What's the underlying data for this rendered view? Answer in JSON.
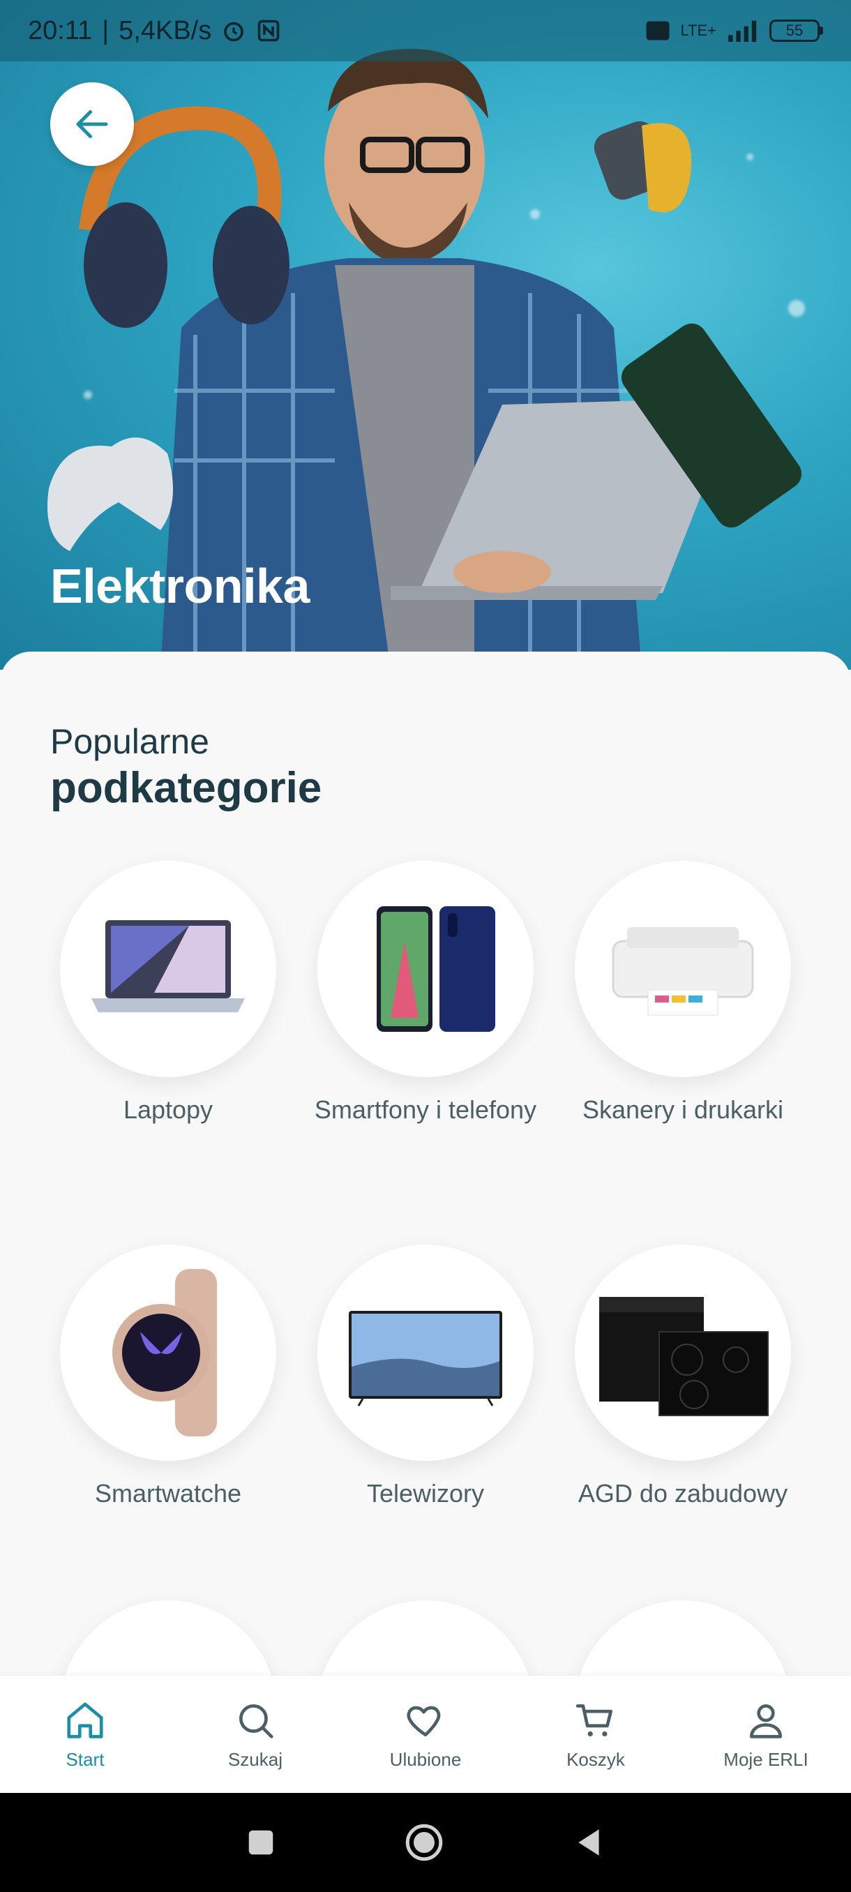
{
  "status_bar": {
    "time": "20:11",
    "speed": "5,4KB/s",
    "network": "LTE+",
    "battery": "55"
  },
  "hero": {
    "title": "Elektronika"
  },
  "section": {
    "subtitle": "Popularne",
    "title": "podkategorie"
  },
  "categories": [
    {
      "label": "Laptopy",
      "icon": "laptop-icon"
    },
    {
      "label": "Smartfony i telefony",
      "icon": "smartphone-icon"
    },
    {
      "label": "Skanery i drukarki",
      "icon": "printer-icon"
    },
    {
      "label": "Smartwatche",
      "icon": "smartwatch-icon"
    },
    {
      "label": "Telewizory",
      "icon": "tv-icon"
    },
    {
      "label": "AGD do zabudowy",
      "icon": "oven-icon"
    }
  ],
  "bottom_nav": [
    {
      "label": "Start",
      "icon": "home-icon",
      "active": true
    },
    {
      "label": "Szukaj",
      "icon": "search-icon",
      "active": false
    },
    {
      "label": "Ulubione",
      "icon": "heart-icon",
      "active": false
    },
    {
      "label": "Koszyk",
      "icon": "cart-icon",
      "active": false
    },
    {
      "label": "Moje ERLI",
      "icon": "user-icon",
      "active": false
    }
  ],
  "colors": {
    "accent": "#1b8fa8",
    "text_dark": "#1e3a44",
    "text_muted": "#4a5f66"
  }
}
